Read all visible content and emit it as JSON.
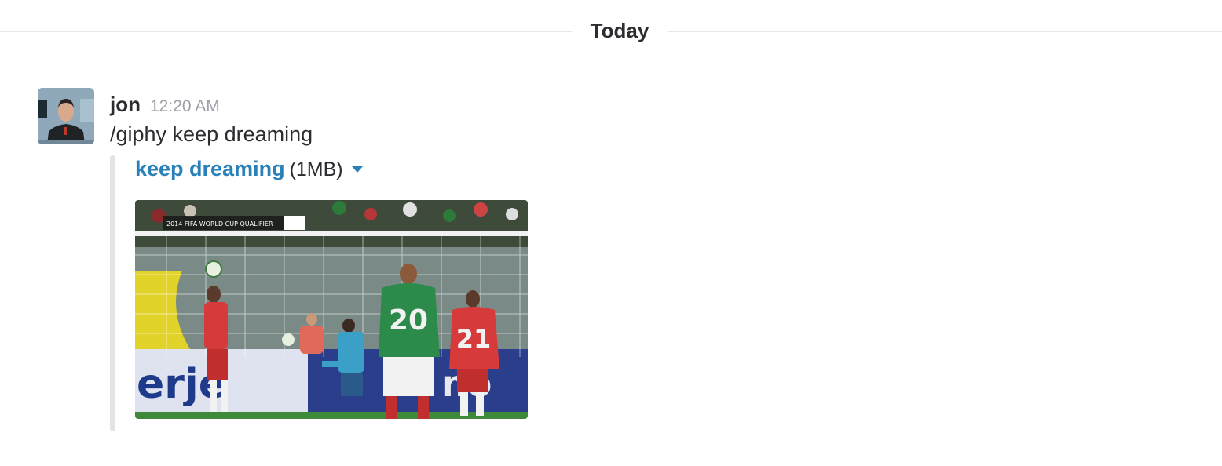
{
  "divider": {
    "label": "Today"
  },
  "message": {
    "author": "jon",
    "time": "12:20 AM",
    "text": "/giphy keep dreaming",
    "avatar_icon": "user-avatar"
  },
  "attachment": {
    "title": "keep dreaming",
    "size": "(1MB)",
    "caret_icon": "caret-down-icon",
    "accent_color": "#2a80b9",
    "image_icon": "soccer-gif-image",
    "scoreboard": "2014 FIFA WORLD CUP QUALIFIER",
    "jersey_numbers": [
      "20",
      "21"
    ]
  }
}
